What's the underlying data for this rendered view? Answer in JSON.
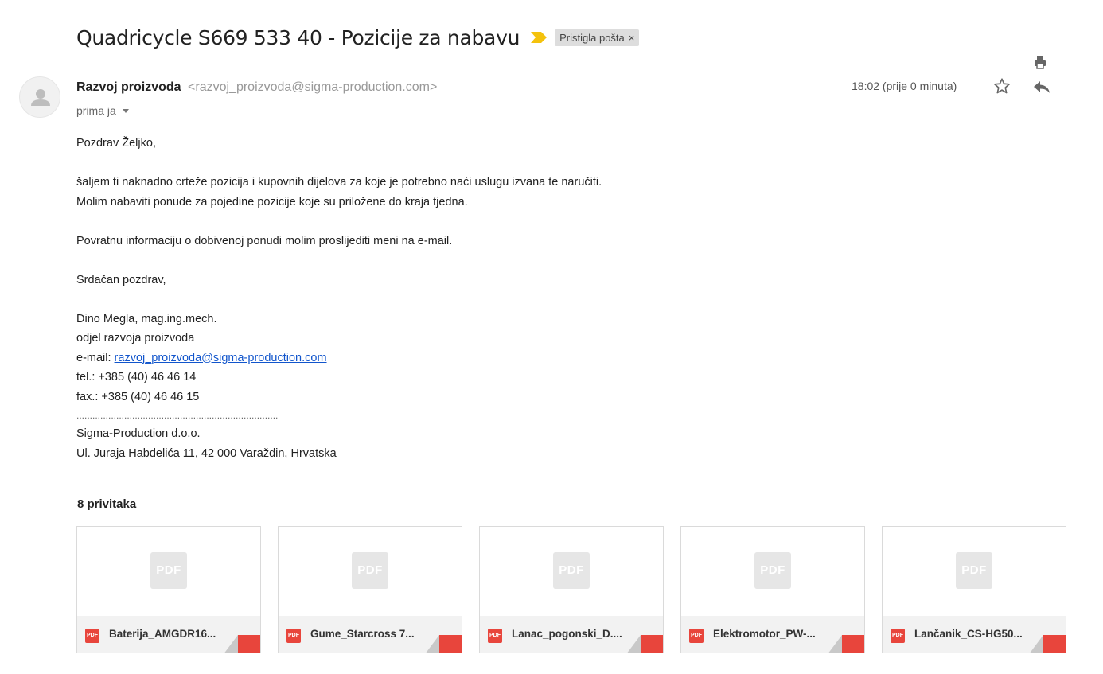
{
  "email": {
    "subject": "Quadricycle S669 533 40 - Pozicije za nabavu",
    "label": "Pristigla pošta",
    "label_close": "×",
    "sender_name": "Razvoj proizvoda",
    "sender_email": "<razvoj_proizvoda@sigma-production.com>",
    "recipient": "prima ja",
    "timestamp": "18:02 (prije 0 minuta)",
    "icons": {
      "importance": "importance-marker-icon",
      "print": "print-icon",
      "star": "star-icon",
      "reply": "reply-icon",
      "avatar": "default-avatar-icon"
    },
    "colors": {
      "importance": "#f4c20d",
      "link": "#1155cc",
      "pdf": "#e8453c"
    }
  },
  "body": {
    "greeting": "Pozdrav Željko,",
    "line1": "šaljem ti naknadno crteže pozicija i kupovnih dijelova za koje je potrebno naći uslugu izvana te naručiti.",
    "line2": "Molim nabaviti ponude za pojedine pozicije koje su priložene do kraja tjedna.",
    "line3": "Povratnu informaciju o dobivenoj ponudi molim proslijediti meni na e-mail.",
    "closing": "Srdačan pozdrav,",
    "sig_name": "Dino Megla, mag.ing.mech.",
    "sig_dept": "odjel razvoja proizvoda",
    "sig_email_label": "e-mail: ",
    "sig_email": "razvoj_proizvoda@sigma-production.com",
    "sig_tel": "tel.: +385 (40) 46 46 14",
    "sig_fax": "fax.: +385 (40) 46 46 15",
    "sig_separator": "............................................................................",
    "company": "Sigma-Production d.o.o.",
    "address": "Ul. Juraja Habdelića 11, 42 000 Varaždin, Hrvatska"
  },
  "attachments": {
    "title": "8 privitaka",
    "thumb_label": "PDF",
    "type_badge": "PDF",
    "items": [
      {
        "name": "Baterija_AMGDR16..."
      },
      {
        "name": "Gume_Starcross 7..."
      },
      {
        "name": "Lanac_pogonski_D...."
      },
      {
        "name": "Elektromotor_PW-..."
      },
      {
        "name": "Lančanik_CS-HG50..."
      }
    ]
  }
}
